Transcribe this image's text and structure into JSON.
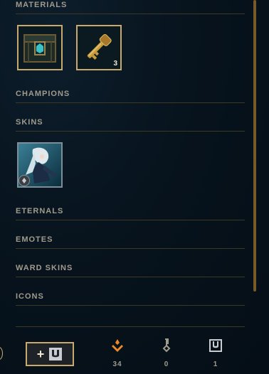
{
  "sections": {
    "materials": "MATERIALS",
    "champions": "CHAMPIONS",
    "skins": "SKINS",
    "eternals": "ETERNALS",
    "emotes": "EMOTES",
    "ward_skins": "WARD SKINS",
    "icons": "ICONS"
  },
  "materials": [
    {
      "name": "hextech-chest",
      "count": ""
    },
    {
      "name": "key",
      "count": "3"
    }
  ],
  "skins": [
    {
      "name": "skin-shard",
      "rarity_icon": "rarity-emblem-icon"
    }
  ],
  "footer": {
    "craft_plus": "+",
    "currencies": [
      {
        "icon": "orange-essence-icon",
        "value": "34",
        "color": "#f08a24"
      },
      {
        "icon": "key-fragment-icon",
        "value": "0",
        "color": "#a09b8c"
      },
      {
        "icon": "chest-icon",
        "value": "1",
        "color": "#a09b8c"
      }
    ]
  },
  "colors": {
    "gold": "#c8aa6e",
    "header_text": "#a09b8c",
    "divider": "#3c3824",
    "orange": "#f08a24"
  }
}
